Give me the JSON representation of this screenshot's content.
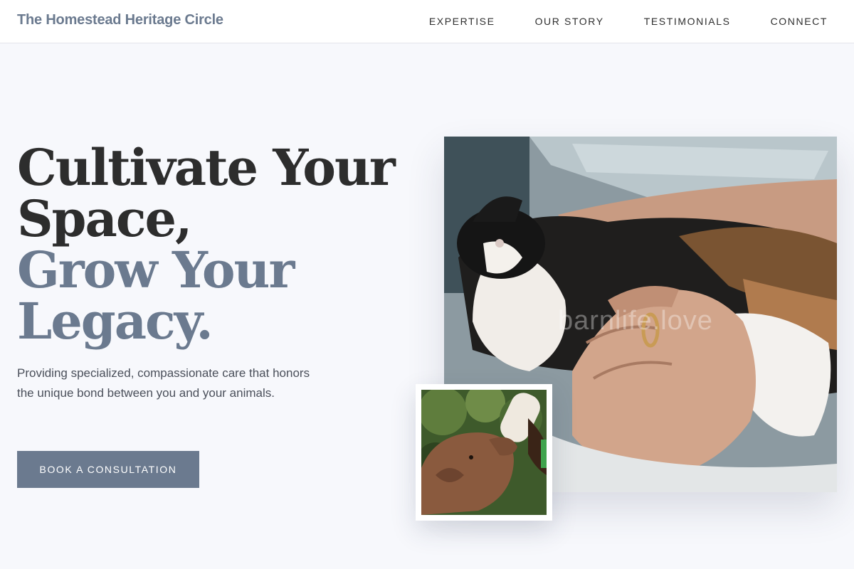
{
  "header": {
    "brand": "The Homestead Heritage Circle",
    "nav": [
      {
        "label": "EXPERTISE"
      },
      {
        "label": "OUR STORY"
      },
      {
        "label": "TESTIMONIALS"
      },
      {
        "label": "CONNECT"
      }
    ]
  },
  "hero": {
    "headline_line1": "Cultivate Your",
    "headline_line2": "Space,",
    "headline_line3": "Grow Your",
    "headline_line4": "Legacy.",
    "subtitle": "Providing specialized, compassionate care that honors the unique bond between you and your animals.",
    "cta_label": "BOOK A CONSULTATION"
  },
  "images": {
    "main_photo_watermark": "barnlife.love"
  },
  "colors": {
    "accent": "#6b7a8f",
    "heading": "#2d2d2d",
    "background": "#f7f8fc"
  }
}
